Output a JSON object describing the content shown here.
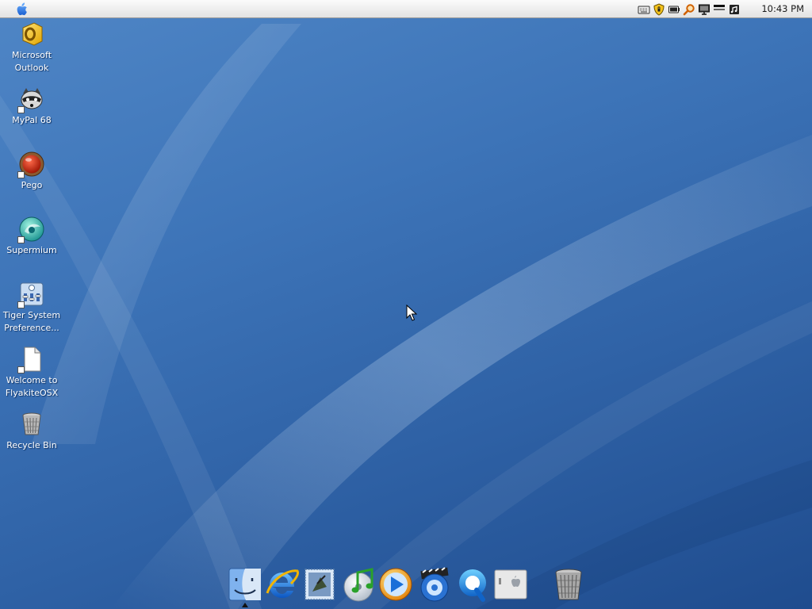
{
  "menubar": {
    "apple_icon": "apple-logo-icon",
    "tray_icons": [
      "keyboard-icon",
      "security-shield-icon",
      "battery-icon",
      "search-icon",
      "monitor-icon",
      "network-icon",
      "volume-icon"
    ],
    "clock": "10:43 PM"
  },
  "desktop": {
    "icons": [
      {
        "label": "Microsoft\nOutlook",
        "icon": "outlook-icon"
      },
      {
        "label": "MyPal 68",
        "icon": "mypal-raccoon-icon",
        "shortcut": true
      },
      {
        "label": "Pego",
        "icon": "pego-icon",
        "shortcut": true
      },
      {
        "label": "Supermium",
        "icon": "supermium-icon",
        "shortcut": true
      },
      {
        "label": "Tiger System\nPreference...",
        "icon": "system-preferences-icon",
        "shortcut": true
      },
      {
        "label": "Welcome to\nFlyakiteOSX",
        "icon": "document-icon",
        "shortcut": true
      },
      {
        "label": "Recycle Bin",
        "icon": "recycle-bin-icon"
      }
    ]
  },
  "dock": {
    "items": [
      "finder-icon",
      "internet-explorer-icon",
      "mail-icon",
      "itunes-icon",
      "media-player-icon",
      "dvd-player-icon",
      "quicktime-icon",
      "system-icon",
      "trash-icon"
    ]
  },
  "colors": {
    "wallpaper_top": "#4f86c6",
    "wallpaper_bottom": "#1f4c8e",
    "menubar": "#eeeeee",
    "icon_label": "#ffffff"
  }
}
